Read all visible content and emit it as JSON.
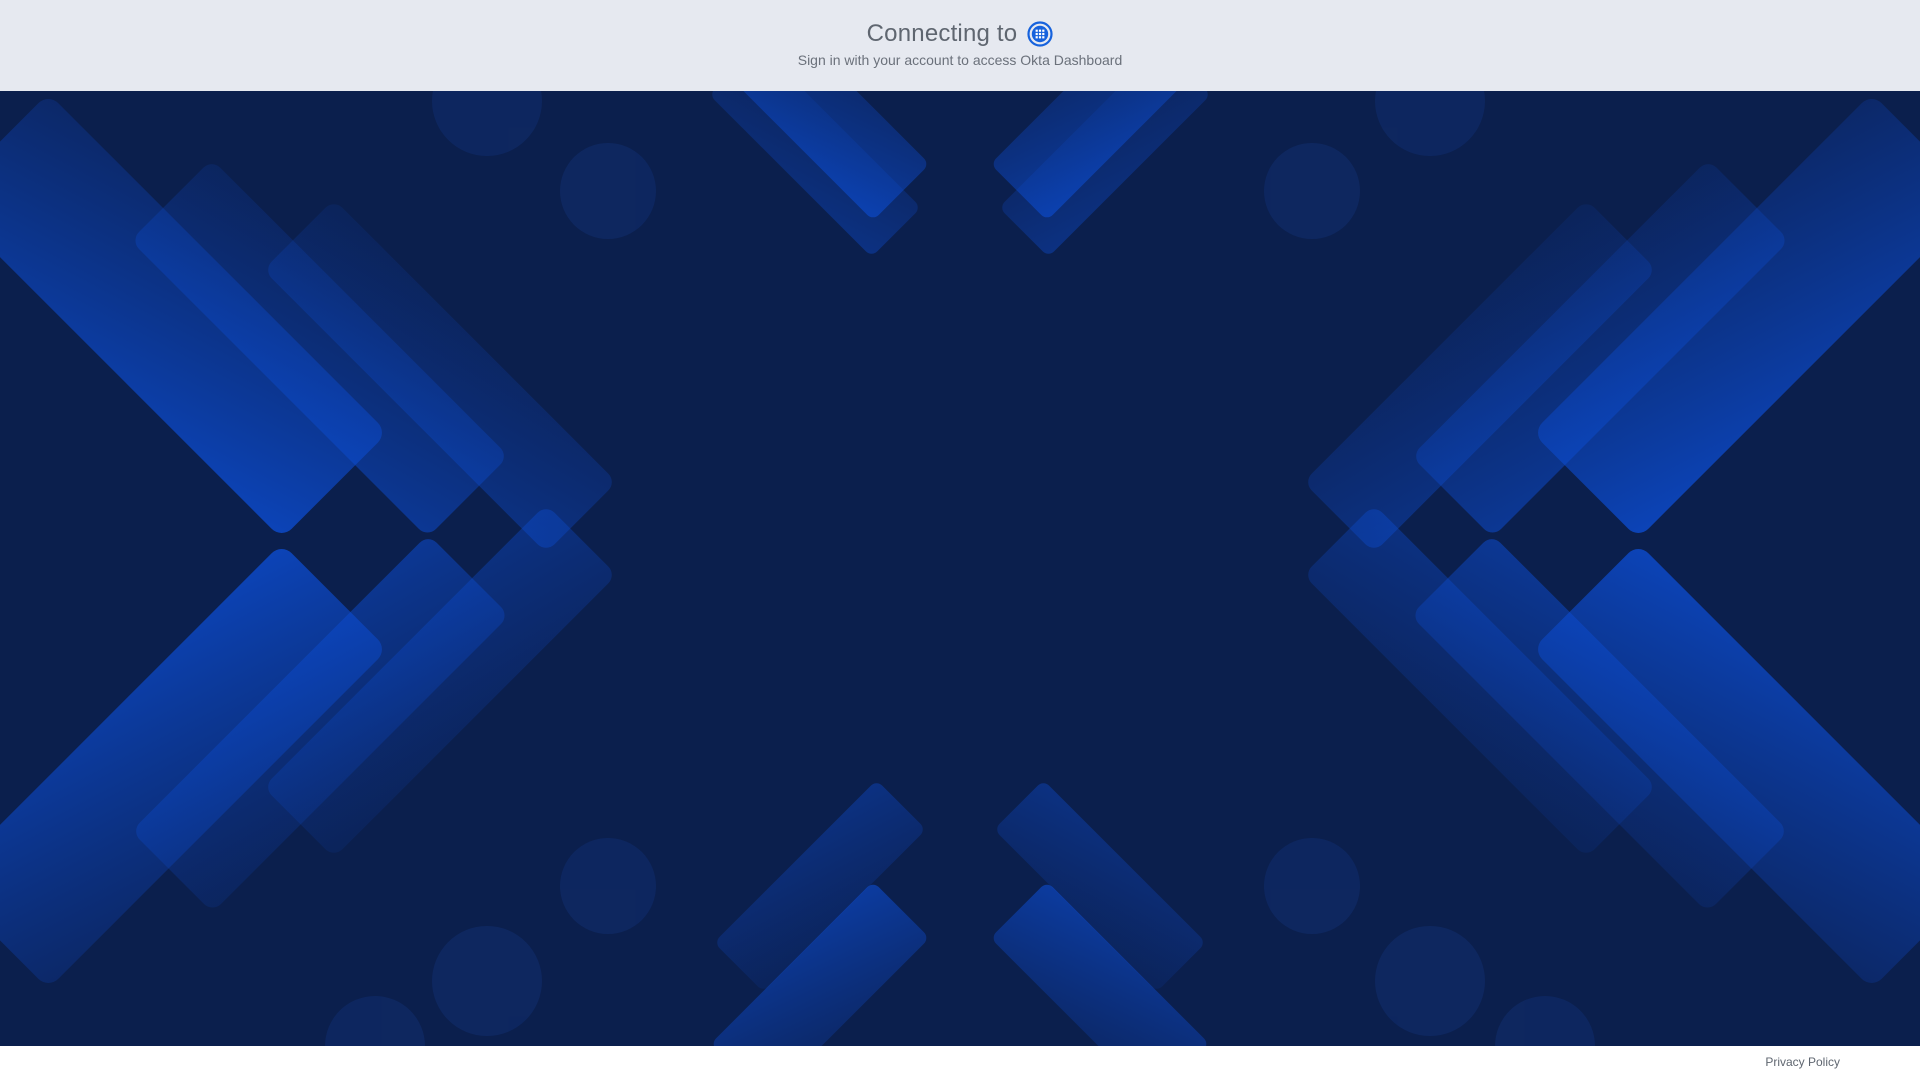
{
  "header": {
    "title": "Connecting to",
    "app_icon": "okta-dashboard-grid-icon",
    "subtitle": "Sign in with your account to access Okta Dashboard"
  },
  "footer": {
    "privacy_label": "Privacy Policy"
  },
  "colors": {
    "header_bg": "#e6e9f0",
    "background": "#0b1f4d",
    "shape_blue": "#0b4fd6",
    "icon_blue": "#1662dd",
    "text_gray": "#5f6670"
  }
}
